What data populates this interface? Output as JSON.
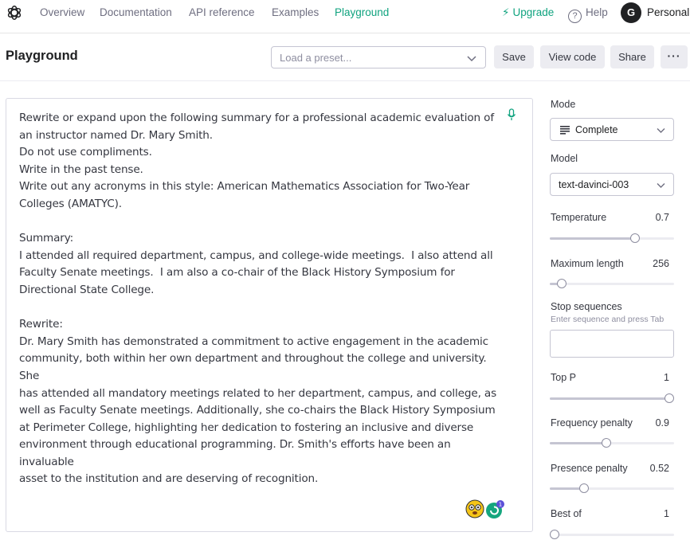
{
  "nav": {
    "links": [
      "Overview",
      "Documentation",
      "API reference",
      "Examples",
      "Playground"
    ],
    "active": "Playground",
    "upgrade": "Upgrade",
    "help": "Help",
    "avatar_initial": "G",
    "account": "Personal"
  },
  "header": {
    "title": "Playground",
    "preset_placeholder": "Load a preset...",
    "buttons": {
      "save": "Save",
      "view_code": "View code",
      "share": "Share",
      "more": "···"
    }
  },
  "editor": {
    "text": "Rewrite or expand upon the following summary for a professional academic evaluation of\nan instructor named Dr. Mary Smith.\nDo not use compliments.\nWrite in the past tense.\nWrite out any acronyms in this style: American Mathematics Association for Two-Year\nColleges (AMATYC).\n\nSummary:\nI attended all required department, campus, and college-wide meetings.  I also attend all\nFaculty Senate meetings.  I am also a co-chair of the Black History Symposium for\nDirectional State College.\n\nRewrite:\nDr. Mary Smith has demonstrated a commitment to active engagement in the academic\ncommunity, both within her own department and throughout the college and university. She\nhas attended all mandatory meetings related to her department, campus, and college, as\nwell as Faculty Senate meetings. Additionally, she co-chairs the Black History Symposium\nat Perimeter College, highlighting her dedication to fostering an inclusive and diverse\nenvironment through educational programming. Dr. Smith's efforts have been an invaluable\nasset to the institution and are deserving of recognition.",
    "extension_badge": "1"
  },
  "settings": {
    "mode": {
      "label": "Mode",
      "value": "Complete"
    },
    "model": {
      "label": "Model",
      "value": "text-davinci-003"
    },
    "temperature": {
      "label": "Temperature",
      "value": "0.7",
      "fraction": 0.7
    },
    "max_length": {
      "label": "Maximum length",
      "value": "256",
      "fraction": 0.06
    },
    "stop_sequences": {
      "label": "Stop sequences",
      "hint": "Enter sequence and press Tab"
    },
    "top_p": {
      "label": "Top P",
      "value": "1",
      "fraction": 1.0
    },
    "frequency_penalty": {
      "label": "Frequency penalty",
      "value": "0.9",
      "fraction": 0.45
    },
    "presence_penalty": {
      "label": "Presence penalty",
      "value": "0.52",
      "fraction": 0.26
    },
    "best_of": {
      "label": "Best of",
      "value": "1",
      "fraction": 0.0
    }
  },
  "colors": {
    "accent": "#10a37f",
    "text": "#202123",
    "muted": "#6e6e80",
    "button_bg": "#ececf1"
  }
}
